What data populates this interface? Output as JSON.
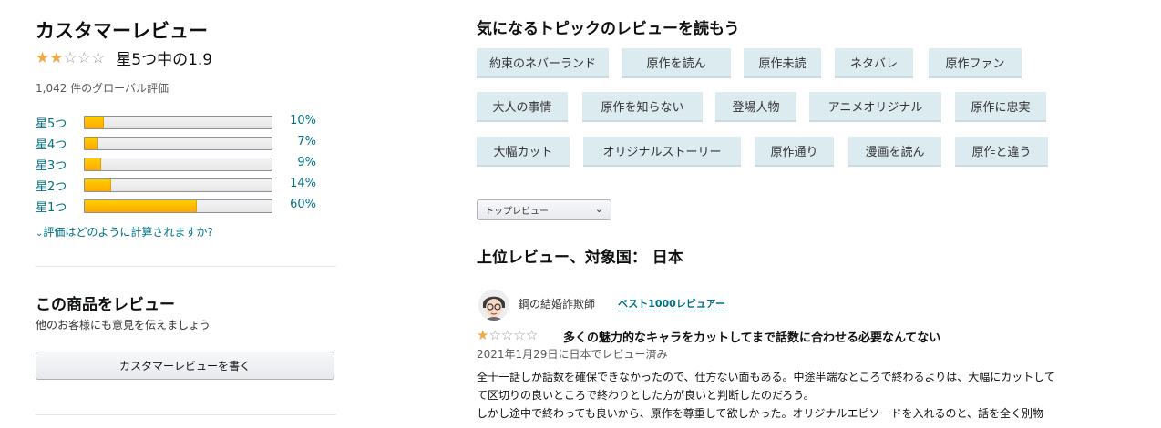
{
  "summary": {
    "title": "カスタマーレビュー",
    "stars_value": 1.9,
    "avg_text": "星5つ中の1.9",
    "global_count": "1,042 件のグローバル評価",
    "histogram": [
      {
        "label": "星5つ",
        "percent_text": "10%",
        "percent": 10
      },
      {
        "label": "星4つ",
        "percent_text": "7%",
        "percent": 7
      },
      {
        "label": "星3つ",
        "percent_text": "9%",
        "percent": 9
      },
      {
        "label": "星2つ",
        "percent_text": "14%",
        "percent": 14
      },
      {
        "label": "星1つ",
        "percent_text": "60%",
        "percent": 60
      }
    ],
    "how_link": "評価はどのように計算されますか?"
  },
  "write_review": {
    "title": "この商品をレビュー",
    "subtitle": "他のお客様にも意見を伝えましょう",
    "button": "カスタマーレビューを書く"
  },
  "topics": {
    "title": "気になるトピックのレビューを読もう",
    "rows": [
      [
        "約束のネバーランド",
        "原作を読ん",
        "原作未読",
        "ネタバレ",
        "原作ファン"
      ],
      [
        "大人の事情",
        "原作を知らない",
        "登場人物",
        "アニメオリジナル",
        "原作に忠実"
      ],
      [
        "大幅カット",
        "オリジナルストーリー",
        "原作通り",
        "漫画を読ん",
        "原作と違う"
      ]
    ]
  },
  "sort": {
    "selected": "トップレビュー"
  },
  "top_reviews_title": "上位レビュー、対象国： 日本",
  "review": {
    "reviewer": "鋼の結婚詐欺師",
    "badge": "ベスト1000レビュアー",
    "stars_value": 1,
    "title": "多くの魅力的なキャラをカットしてまで話数に合わせる必要なんてない",
    "date": "2021年1月29日に日本でレビュー済み",
    "body": [
      "全十一話しか話数を確保できなかったので、仕方ない面もある。中途半端なところで終わるよりは、大幅にカットして",
      "て区切りの良いところで終わりとした方が良いと判断したのだろう。",
      "しかし途中で終わっても良いから、原作を尊重して欲しかった。オリジナルエピソードを入れるのと、話を全く別物"
    ]
  },
  "colors": {
    "star": "#f3a847",
    "bar_fill": "#ffa700",
    "link": "#007185",
    "chip_bg": "#dcebf0"
  }
}
